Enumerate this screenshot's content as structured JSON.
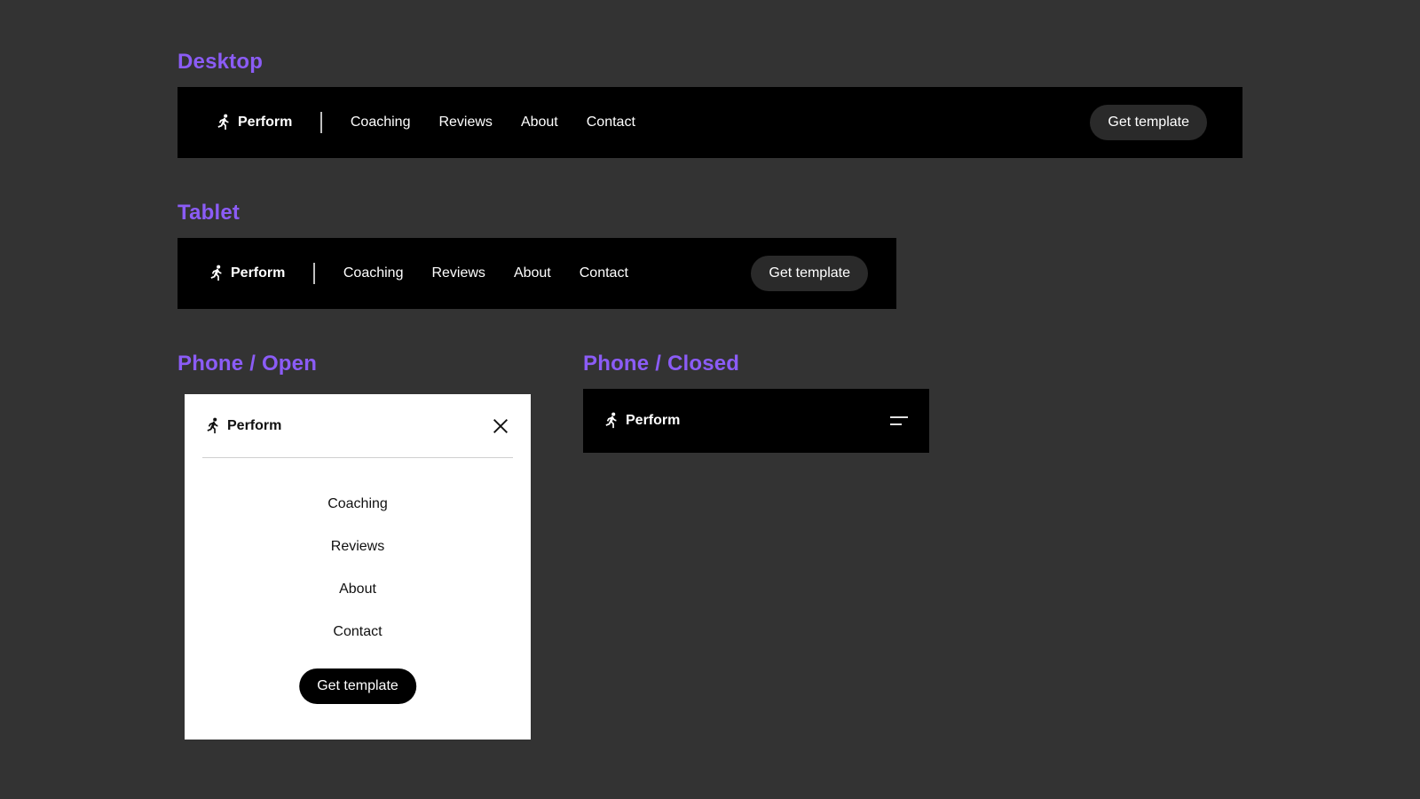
{
  "sections": {
    "desktop": "Desktop",
    "tablet": "Tablet",
    "phone_open": "Phone / Open",
    "phone_closed": "Phone / Closed"
  },
  "brand": {
    "name": "Perform",
    "icon": "running-person-icon"
  },
  "nav": {
    "links": [
      "Coaching",
      "Reviews",
      "About",
      "Contact"
    ],
    "cta_label": "Get template"
  },
  "icons": {
    "close": "close-icon",
    "menu": "hamburger-menu-icon"
  },
  "colors": {
    "page_bg": "#333333",
    "section_label": "#8B5CF6",
    "nav_bg": "#000000",
    "cta_dark_bg": "#2a2a2a",
    "panel_bg": "#ffffff"
  }
}
